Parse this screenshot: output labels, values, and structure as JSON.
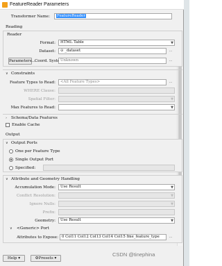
{
  "window": {
    "title": "FeatureReader Parameters"
  },
  "transformer": {
    "label": "Transformer Name:",
    "value": "FeatureReader"
  },
  "sections": {
    "reading": "Reading",
    "output": "Output"
  },
  "reader": {
    "header": "Reader",
    "format_label": "Format:",
    "format_value": "HTML Table",
    "dataset_label": "Dataset:",
    "dataset_value": "_dataset",
    "dataset_prefix": "⊙",
    "parameters_button": "Parameters...",
    "coord_label": "Coord. System:",
    "coord_value": "Unknown"
  },
  "constraints": {
    "header": "Constraints",
    "feature_types_label": "Feature Types to Read:",
    "feature_types_value": "<All Feature Types>",
    "where_label": "WHERE Clause:",
    "spatial_label": "Spatial Filter:",
    "max_label": "Max Features to Read:"
  },
  "schema": {
    "header": "Schema/Data Features",
    "enable_cache": "Enable Cache"
  },
  "output_ports": {
    "header": "Output Ports",
    "options": [
      "One per Feature Type",
      "Single Output Port",
      "Specified:"
    ],
    "selected": 1
  },
  "attr": {
    "header": "Attribute and Geometry Handling",
    "accum_label": "Accumulation Mode:",
    "accum_value": "Use Result",
    "conflict_label": "Conflict Resolution:",
    "ignore_label": "Ignore Nulls:",
    "prefix_label": "Prefix:",
    "geometry_label": "Geometry:",
    "geometry_value": "Use Result",
    "generic_header": "<Generic> Port",
    "expose_label": "Attributes to Expose:",
    "expose_value": "0 Col11 Col12 Col13 Col14 Col15 fme_feature_type"
  },
  "footer": {
    "help": "Help",
    "presets": "Presets"
  },
  "watermark": "CSDN @tinephina"
}
